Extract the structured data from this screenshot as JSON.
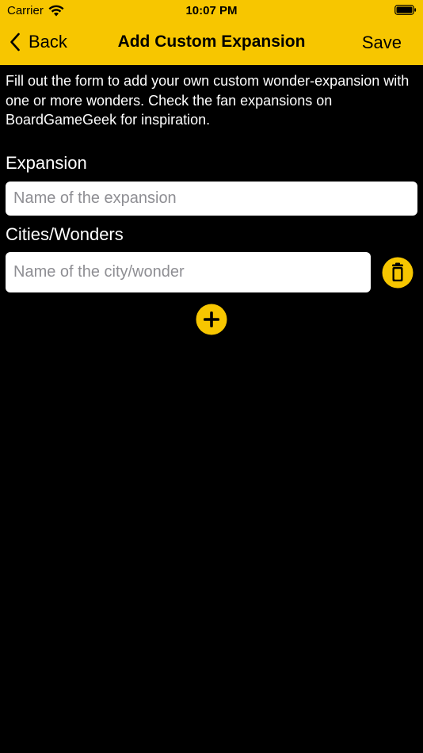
{
  "status_bar": {
    "carrier": "Carrier",
    "time": "10:07 PM",
    "wifi_icon": "wifi-icon",
    "battery_icon": "battery-full-icon"
  },
  "nav": {
    "back_label": "Back",
    "title": "Add Custom Expansion",
    "save_label": "Save",
    "back_icon": "chevron-left-icon"
  },
  "intro_text": "Fill out the form to add your own custom wonder-expansion with one or more wonders. Check the fan expansions on BoardGameGeek for inspiration.",
  "expansion": {
    "label": "Expansion",
    "placeholder": "Name of the expansion",
    "value": ""
  },
  "wonders": {
    "label": "Cities/Wonders",
    "items": [
      {
        "placeholder": "Name of the city/wonder",
        "value": ""
      }
    ],
    "delete_icon": "trash-icon",
    "add_icon": "plus-circle-icon"
  },
  "colors": {
    "accent": "#F7C600",
    "background": "#000000",
    "text": "#FFFFFF",
    "field_background": "#FFFFFF",
    "placeholder": "#8E8E93"
  }
}
